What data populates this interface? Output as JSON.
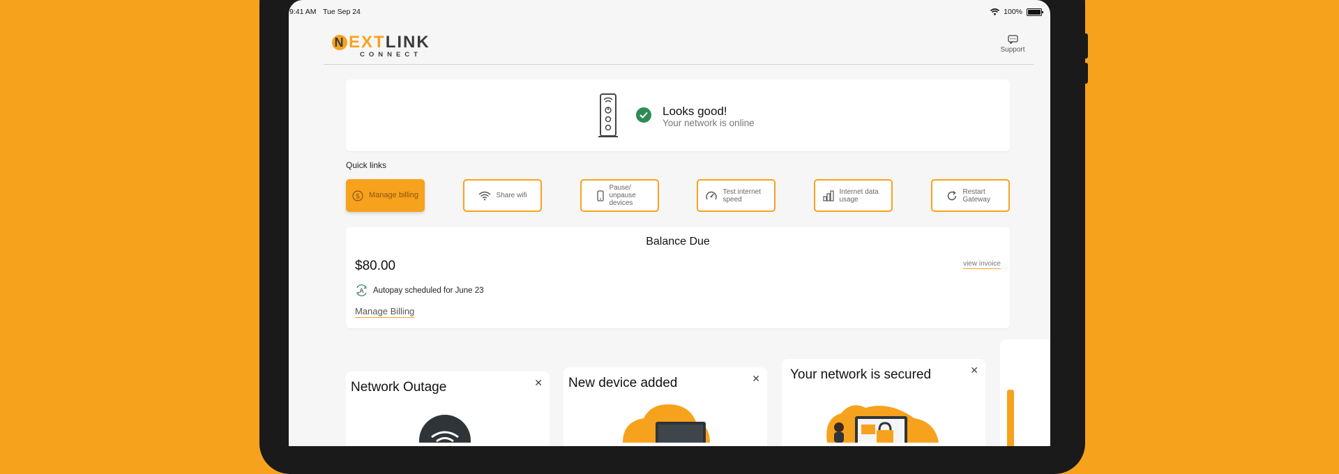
{
  "status_bar": {
    "time": "9:41 AM",
    "date": "Tue Sep 24",
    "battery": "100%"
  },
  "header": {
    "logo_n": "N",
    "logo_ext": "EXT",
    "logo_link": "LINK",
    "logo_sub": "CONNECT",
    "support_label": "Support"
  },
  "network_status": {
    "title": "Looks good!",
    "subtitle": "Your network is online"
  },
  "quick_links": {
    "title": "Quick links",
    "items": [
      {
        "label": "Manage billing",
        "icon": "dollar-icon"
      },
      {
        "label": "Share wifi",
        "icon": "wifi-icon"
      },
      {
        "label": "Pause/ unpause devices",
        "icon": "phone-icon"
      },
      {
        "label": "Test internet speed",
        "icon": "speedometer-icon"
      },
      {
        "label": "Internet data usage",
        "icon": "bar-chart-icon"
      },
      {
        "label": "Restart Gateway",
        "icon": "refresh-icon"
      }
    ]
  },
  "billing": {
    "title": "Balance Due",
    "amount": "$80.00",
    "view_invoice": "view invoice",
    "autopay_text": "Autopay scheduled for June 23",
    "manage_link": "Manage Billing"
  },
  "notifications": [
    {
      "title": "Network Outage"
    },
    {
      "title": "New device added"
    },
    {
      "title": "Your network is secured"
    }
  ],
  "colors": {
    "accent": "#F7A21D",
    "success": "#2E8B57",
    "background": "#F6F6F6"
  }
}
